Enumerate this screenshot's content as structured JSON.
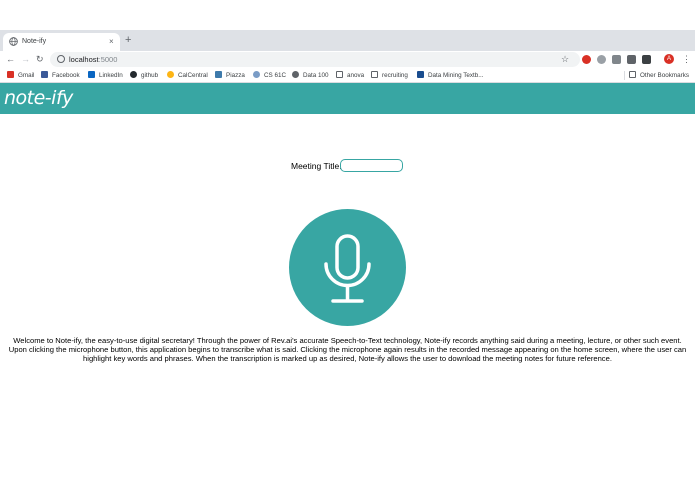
{
  "browser": {
    "tab": {
      "title": "Note-ify",
      "close": "×"
    },
    "new_tab": "+",
    "nav": {
      "back": "←",
      "forward": "→",
      "reload": "↻"
    },
    "omnibox": {
      "host": "localhost",
      "port": ":5000"
    },
    "star": "☆",
    "avatar_initial": "A",
    "menu": "⋮",
    "bookmarks": [
      {
        "label": "Gmail",
        "icon": "gmail-icon",
        "color": "#d93025"
      },
      {
        "label": "Facebook",
        "icon": "facebook-icon",
        "color": "#3b5998"
      },
      {
        "label": "LinkedIn",
        "icon": "linkedin-icon",
        "color": "#0a66c2"
      },
      {
        "label": "github",
        "icon": "github-icon",
        "color": "#24292e"
      },
      {
        "label": "CalCentral",
        "icon": "calcentral-icon",
        "color": "#fdb515"
      },
      {
        "label": "Piazza",
        "icon": "piazza-icon",
        "color": "#3e7aab"
      },
      {
        "label": "CS 61C",
        "icon": "cs61c-icon",
        "color": "#7a9cc6"
      },
      {
        "label": "Data 100",
        "icon": "globe-icon",
        "color": "#5f6368"
      },
      {
        "label": "anova",
        "icon": "folder-icon",
        "color": "#5f6368"
      },
      {
        "label": "recruiting",
        "icon": "folder-icon",
        "color": "#5f6368"
      },
      {
        "label": "Data Mining Textb...",
        "icon": "book-icon",
        "color": "#1a4d8f"
      }
    ],
    "other_bookmarks": "Other Bookmarks"
  },
  "app": {
    "logo": "note-ify",
    "accent": "#38a6a3",
    "meeting": {
      "label": "Meeting Title:",
      "value": "",
      "placeholder": ""
    },
    "mic_icon": "microphone-icon",
    "description": "Welcome to Note-ify, the easy-to-use digital secretary! Through the power of Rev.ai's accurate Speech-to-Text technology, Note-ify records anything said during a meeting, lecture, or other such event. Upon clicking the microphone button, this application begins to transcribe what is said. Clicking the microphone again results in the recorded message appearing on the home screen, where the user can highlight key words and phrases. When the transcription is marked up as desired, Note-ify allows the user to download the meeting notes for future reference."
  }
}
